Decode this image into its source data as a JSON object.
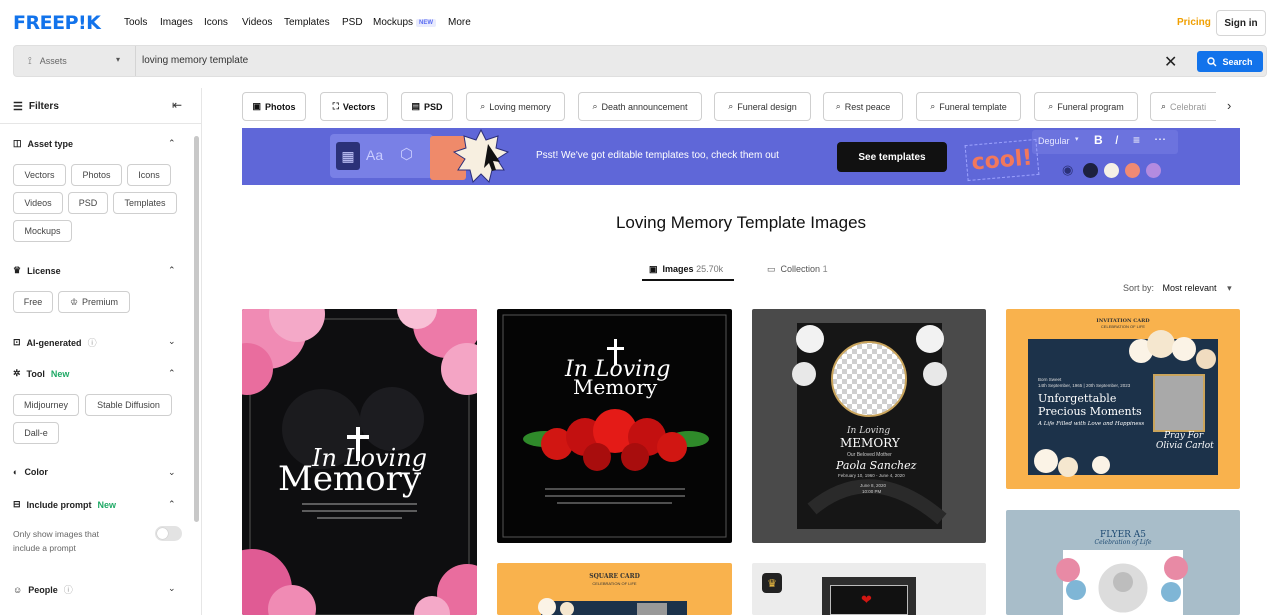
{
  "header": {
    "logo": "FREEP!K",
    "nav": [
      {
        "label": "Tools"
      },
      {
        "label": "Images"
      },
      {
        "label": "Icons"
      },
      {
        "label": "Videos"
      },
      {
        "label": "Templates"
      },
      {
        "label": "PSD"
      },
      {
        "label": "Mockups",
        "badge": "NEW"
      },
      {
        "label": "More"
      }
    ],
    "pricing": "Pricing",
    "sign_in": "Sign in"
  },
  "search": {
    "category": "Assets",
    "query": "loving memory template",
    "button": "Search"
  },
  "sidebar": {
    "title": "Filters",
    "asset_type": {
      "label": "Asset type",
      "options": [
        "Vectors",
        "Photos",
        "Icons",
        "Videos",
        "PSD",
        "Templates",
        "Mockups"
      ]
    },
    "license": {
      "label": "License",
      "options": [
        "Free",
        "Premium"
      ]
    },
    "ai_generated": {
      "label": "AI-generated"
    },
    "tool": {
      "label": "Tool",
      "badge": "New",
      "options": [
        "Midjourney",
        "Stable Diffusion",
        "Dall-e"
      ]
    },
    "color": {
      "label": "Color"
    },
    "include_prompt": {
      "label": "Include prompt",
      "badge": "New",
      "desc_line1": "Only show images that",
      "desc_line2": "include a prompt",
      "enabled": false
    },
    "people": {
      "label": "People"
    }
  },
  "filter_chips": [
    "Photos",
    "Vectors",
    "PSD",
    "Loving memory",
    "Death announcement",
    "Funeral design",
    "Rest peace",
    "Funeral template",
    "Funeral program",
    "Celebrati"
  ],
  "banner": {
    "text": "Psst! We've got editable templates too, check them out",
    "button": "See templates",
    "font_name": "Degular",
    "sample_word": "cool!",
    "swatches": [
      "#1d2140",
      "#f5f1e6",
      "#f08a73",
      "#b48be0"
    ]
  },
  "main": {
    "title": "Loving Memory Template Images",
    "tabs": [
      {
        "label": "Images",
        "count": "25.70k",
        "active": true
      },
      {
        "label": "Collection",
        "count": "1",
        "active": false
      }
    ],
    "sort_label": "Sort by:",
    "sort_value": "Most relevant"
  },
  "cards": {
    "c1": {
      "script": "In Loving",
      "word": "Memory"
    },
    "c2": {
      "script": "In Loving",
      "word": "Memory"
    },
    "c3": {
      "script": "In Loving",
      "word": "MEMORY",
      "sub": "Our Beloved Mother",
      "name": "Paola Sanchez",
      "dates": "February 10, 1960 - June 4, 2020",
      "date2": "June 8, 2020",
      "time": "10:00 PM"
    },
    "c4": {
      "top": "INVITATION CARD",
      "subtop": "CELEBRATION OF LIFE",
      "born": "Born Sweet",
      "dates": "14th September, 1965 | 20th September, 2023",
      "title1": "Unforgettable",
      "title2": "Precious Moments",
      "script1": "A Life Filled with Love and Happiness",
      "script2": "Pray For",
      "script3": "Olivia Carlot"
    },
    "c5": {
      "top": "SQUARE CARD",
      "sub": "CELEBRATION OF LIFE"
    },
    "c7": {
      "top": "FLYER A5",
      "sub": "Celebration of Life"
    }
  }
}
